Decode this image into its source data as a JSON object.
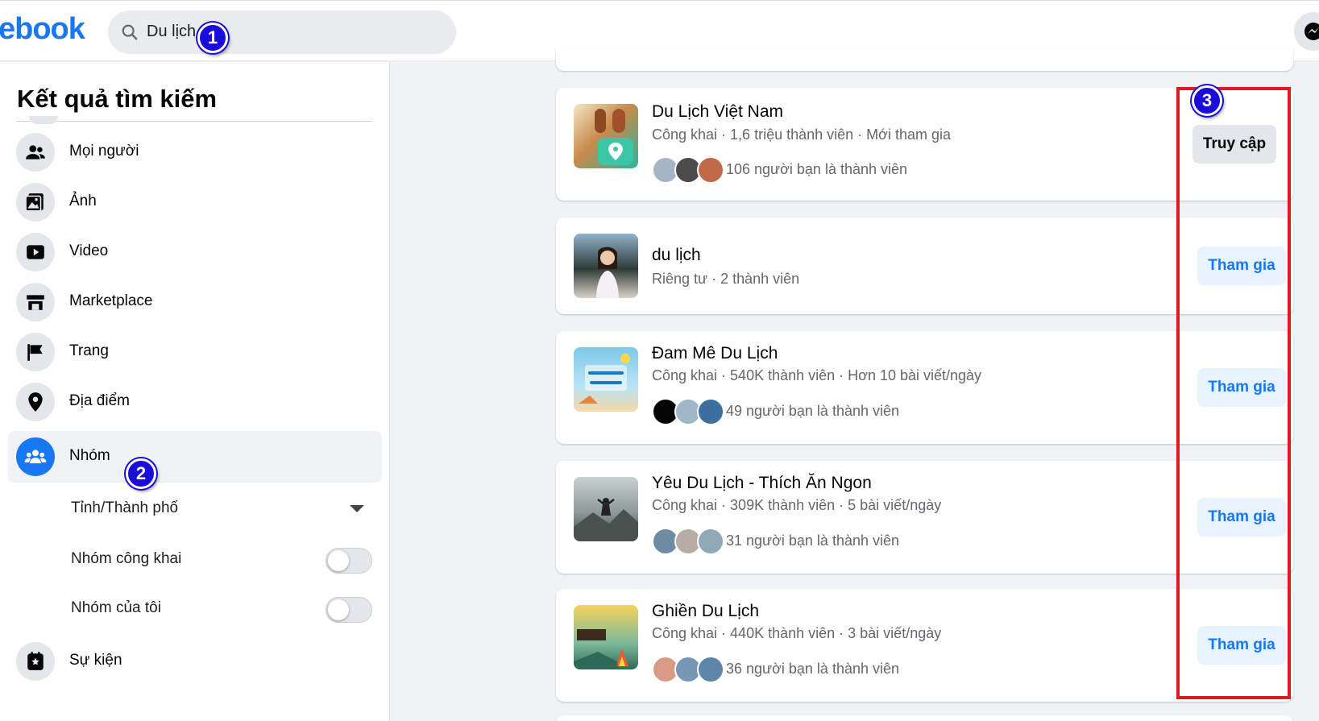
{
  "header": {
    "logo": "ebook",
    "search_value": "Du lịch"
  },
  "markers": [
    "1",
    "2",
    "3"
  ],
  "sidebar": {
    "title": "Kết quả tìm kiếm",
    "items": [
      {
        "label": "Mọi người",
        "icon": "people-icon"
      },
      {
        "label": "Ảnh",
        "icon": "photo-icon"
      },
      {
        "label": "Video",
        "icon": "video-icon"
      },
      {
        "label": "Marketplace",
        "icon": "marketplace-icon"
      },
      {
        "label": "Trang",
        "icon": "flag-icon"
      },
      {
        "label": "Địa điểm",
        "icon": "pin-icon"
      },
      {
        "label": "Nhóm",
        "icon": "groups-icon"
      },
      {
        "label": "Sự kiện",
        "icon": "event-icon"
      }
    ],
    "filters": {
      "city": "Tỉnh/Thành phố",
      "public_groups": "Nhóm công khai",
      "my_groups": "Nhóm của tôi"
    }
  },
  "results": [
    {
      "name": "Du Lịch Việt Nam",
      "meta": "Công khai · 1,6 triệu thành viên · Mới tham gia",
      "friends": "106 người bạn là thành viên",
      "button": "Truy cập"
    },
    {
      "name": "du lịch",
      "meta": "Riêng tư · 2 thành viên",
      "friends": "",
      "button": "Tham gia"
    },
    {
      "name": "Đam Mê Du Lịch",
      "meta": "Công khai · 540K thành viên · Hơn 10 bài viết/ngày",
      "friends": "49 người bạn là thành viên",
      "button": "Tham gia"
    },
    {
      "name": "Yêu Du Lịch - Thích Ăn Ngon",
      "meta": "Công khai · 309K thành viên · 5 bài viết/ngày",
      "friends": "31 người bạn là thành viên",
      "button": "Tham gia"
    },
    {
      "name": "Ghiền Du Lịch",
      "meta": "Công khai · 440K thành viên · 3 bài viết/ngày",
      "friends": "36 người bạn là thành viên",
      "button": "Tham gia"
    }
  ],
  "colors": {
    "brand": "#1877f2",
    "highlight": "#e0191e",
    "marker": "#1a0dd8"
  }
}
